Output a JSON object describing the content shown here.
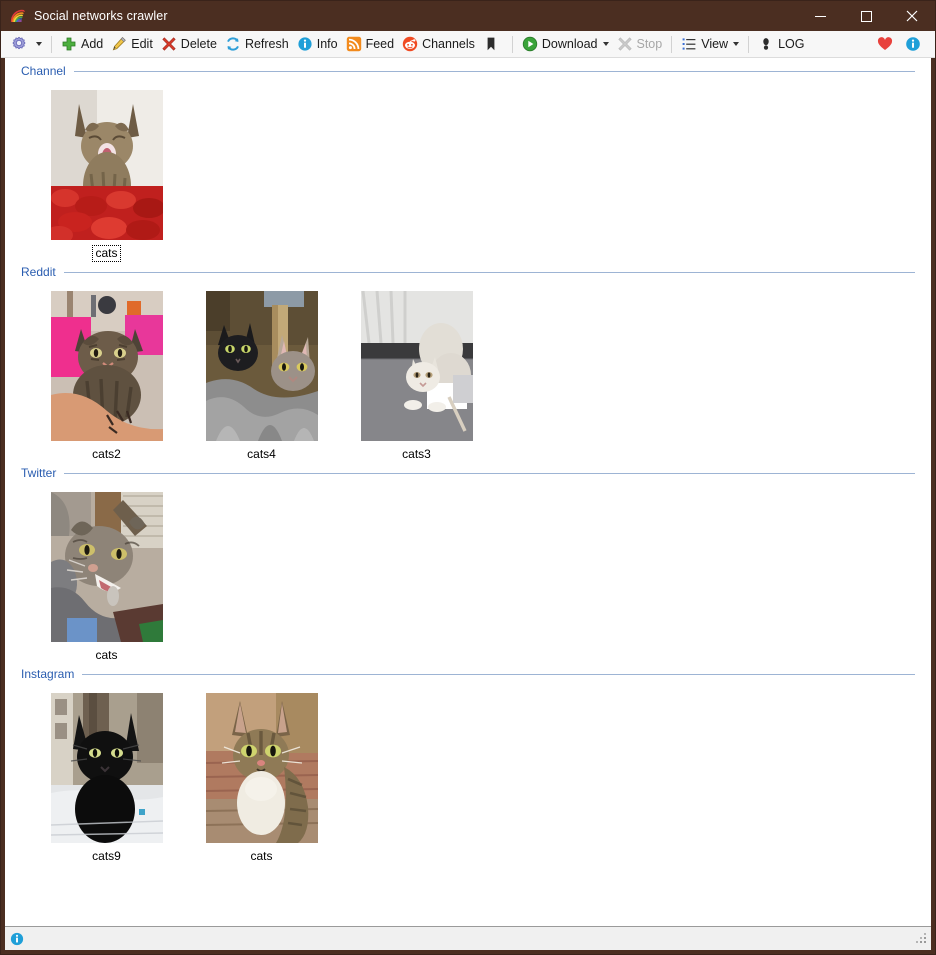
{
  "window": {
    "title": "Social networks crawler",
    "app_icon": "rainbow-icon",
    "titlebar_color": "#4b2e21",
    "controls": {
      "minimize": "minimize-button",
      "maximize": "maximize-button",
      "close": "close-button"
    }
  },
  "toolbar": {
    "settings_label": "",
    "items": [
      {
        "label": "Add",
        "icon": "plus-icon",
        "enabled": true
      },
      {
        "label": "Edit",
        "icon": "pencil-icon",
        "enabled": true
      },
      {
        "label": "Delete",
        "icon": "red-x-icon",
        "enabled": true
      },
      {
        "label": "Refresh",
        "icon": "refresh-icon",
        "enabled": true
      },
      {
        "label": "Info",
        "icon": "info-icon",
        "enabled": true
      },
      {
        "label": "Feed",
        "icon": "rss-icon",
        "enabled": true
      },
      {
        "label": "Channels",
        "icon": "reddit-icon",
        "enabled": true
      },
      {
        "label": "Download",
        "icon": "play-icon",
        "enabled": true
      },
      {
        "label": "Stop",
        "icon": "stop-x-icon",
        "enabled": false
      },
      {
        "label": "View",
        "icon": "list-icon",
        "enabled": true
      },
      {
        "label": "LOG",
        "icon": "footprint-icon",
        "enabled": true
      }
    ],
    "right_icons": [
      {
        "name": "heart-icon",
        "color": "#e8413c"
      },
      {
        "name": "info-icon",
        "color": "#1f9fd8"
      }
    ]
  },
  "colors": {
    "group_title": "#2a5db0",
    "group_rule": "#9db4d4",
    "frame": "#4b2e21",
    "toolbar_bg": "#f7f7f7",
    "status_bg": "#f0f0f0"
  },
  "groups": [
    {
      "title": "Channel",
      "items": [
        {
          "label": "cats",
          "image": "cat-tabby-red-petals",
          "focused": true
        }
      ]
    },
    {
      "title": "Reddit",
      "items": [
        {
          "label": "cats2",
          "image": "cat-tabby-pink-bed-tattoo",
          "focused": false
        },
        {
          "label": "cats4",
          "image": "cat-black-and-grey-blanket",
          "focused": false
        },
        {
          "label": "cats3",
          "image": "cat-white-stretching-floor",
          "focused": false
        }
      ]
    },
    {
      "title": "Twitter",
      "items": [
        {
          "label": "cats",
          "image": "cat-tabby-yawning-held",
          "focused": false
        }
      ]
    },
    {
      "title": "Instagram",
      "items": [
        {
          "label": "cats9",
          "image": "cat-black-snow-outdoor",
          "focused": false
        },
        {
          "label": "cats",
          "image": "cat-tabby-brick-wall",
          "focused": false
        }
      ]
    }
  ],
  "statusbar": {
    "icon": "info-icon",
    "text": "",
    "grip": "resize-grip"
  }
}
